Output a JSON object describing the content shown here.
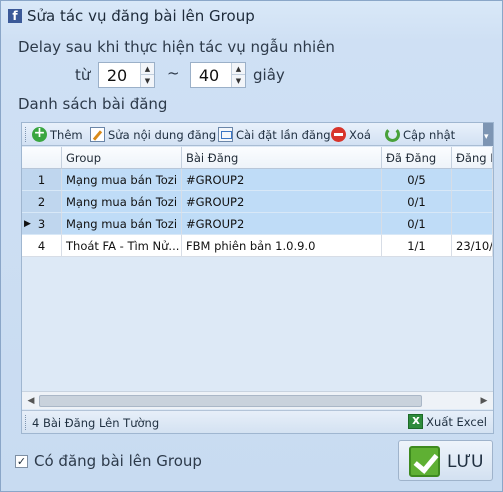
{
  "window": {
    "title": "Sửa tác vụ đăng bài lên Group",
    "icon": "facebook-icon"
  },
  "delay": {
    "label": "Delay sau khi thực hiện tác vụ ngẫu nhiên",
    "from_label": "từ",
    "from_value": "20",
    "separator": "~",
    "to_value": "40",
    "unit_label": "giây"
  },
  "posts_section": {
    "label": "Danh sách bài đăng"
  },
  "toolbar": {
    "add_label": "Thêm",
    "edit_label": "Sửa nội dung đăng",
    "settings_label": "Cài đặt lần đăng",
    "delete_label": "Xoá",
    "refresh_label": "Cập nhật"
  },
  "table": {
    "columns": [
      "Group",
      "Bài Đăng",
      "Đã Đăng",
      "Đăng L"
    ],
    "rows": [
      {
        "num": "1",
        "group": "Mạng mua bán Tozi",
        "post": "#GROUP2",
        "posted": "0/5",
        "last": ""
      },
      {
        "num": "2",
        "group": "Mạng mua bán Tozi",
        "post": "#GROUP2",
        "posted": "0/1",
        "last": ""
      },
      {
        "num": "3",
        "group": "Mạng mua bán Tozi",
        "post": "#GROUP2",
        "posted": "0/1",
        "last": ""
      },
      {
        "num": "4",
        "group": "Thoát FA - Tìm Nử...",
        "post": "FBM phiên bản 1.0.9.0",
        "posted": "1/1",
        "last": "23/10/"
      }
    ]
  },
  "status": {
    "count_label": "4 Bài Đăng Lên Tường",
    "export_label": "Xuất Excel"
  },
  "footer": {
    "checkbox_label": "Có đăng bài lên Group",
    "checkbox_checked": "✓",
    "save_label": "LƯU"
  }
}
